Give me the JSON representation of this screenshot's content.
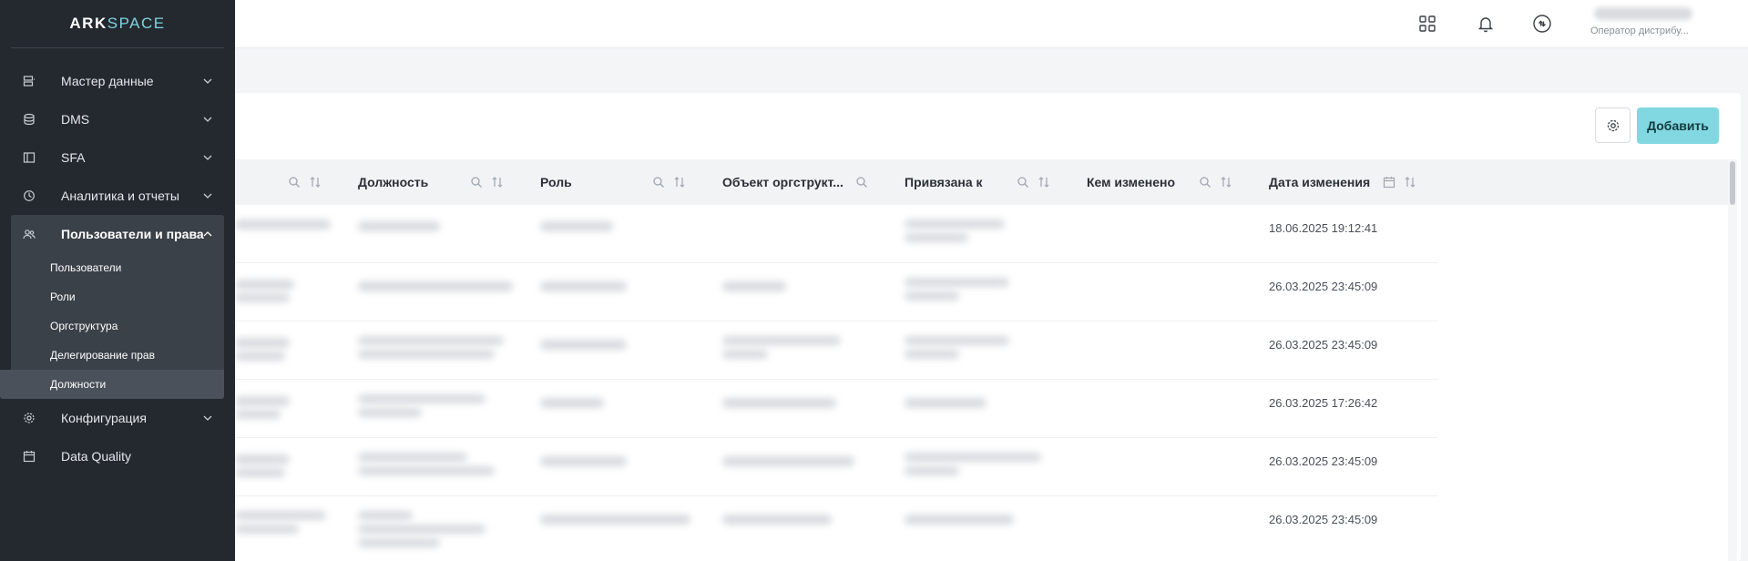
{
  "brand": {
    "part1": "ARK",
    "part2": "SPACE",
    "accent": "#7fd4df"
  },
  "sidebar": {
    "items": [
      {
        "label": "Мастер данные",
        "icon": "master-data-icon"
      },
      {
        "label": "DMS",
        "icon": "database-icon"
      },
      {
        "label": "SFA",
        "icon": "sfa-icon"
      },
      {
        "label": "Аналитика и отчеты",
        "icon": "analytics-icon"
      },
      {
        "label": "Пользователи и права",
        "icon": "users-icon",
        "expanded": true,
        "children": [
          "Пользователи",
          "Роли",
          "Оргструктура",
          "Делегирование прав",
          "Должности"
        ],
        "active_child": "Должности"
      },
      {
        "label": "Конфигурация",
        "icon": "gear-icon"
      },
      {
        "label": "Data Quality",
        "icon": "calendar-icon"
      }
    ]
  },
  "topbar": {
    "icons": [
      "apps-grid-icon",
      "bell-icon",
      "sync-icon"
    ],
    "user_role": "Оператор дистрибу..."
  },
  "toolbar": {
    "add_label": "Добавить"
  },
  "table": {
    "columns": [
      {
        "label": "",
        "filter": "search",
        "sort": true
      },
      {
        "label": "Должность",
        "filter": "search",
        "sort": true
      },
      {
        "label": "Роль",
        "filter": "search",
        "sort": true
      },
      {
        "label": "Объект оргструкт...",
        "filter": "search",
        "sort": false
      },
      {
        "label": "Привязана к",
        "filter": "search",
        "sort": true
      },
      {
        "label": "Кем изменено",
        "filter": "search",
        "sort": true
      },
      {
        "label": "Дата изменения",
        "filter": "calendar",
        "sort": true
      }
    ],
    "rows": [
      {
        "date": "18.06.2025 19:12:41"
      },
      {
        "date": "26.03.2025 23:45:09"
      },
      {
        "date": "26.03.2025 23:45:09"
      },
      {
        "date": "26.03.2025 17:26:42"
      },
      {
        "date": "26.03.2025 23:45:09"
      },
      {
        "date": "26.03.2025 23:45:09"
      }
    ]
  },
  "colors": {
    "sidebar_bg": "#24292f",
    "add_button": "#82d8e0",
    "highlight": "#d81c22"
  }
}
